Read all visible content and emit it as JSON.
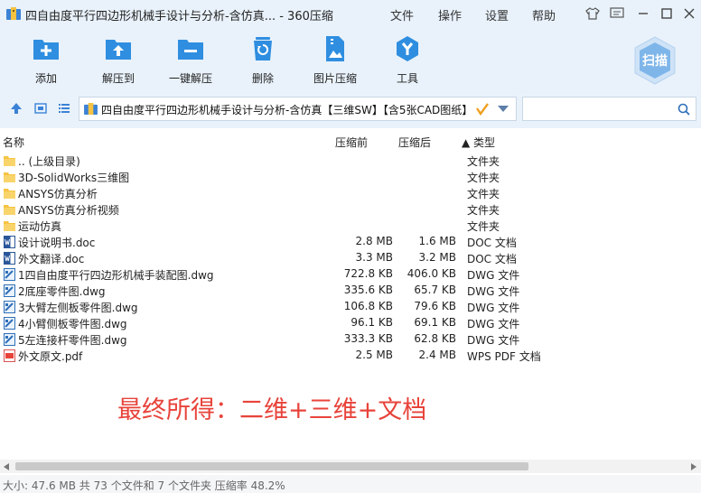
{
  "window": {
    "title": "四自由度平行四边形机械手设计与分析-含仿真... - 360压缩",
    "menus": [
      "文件",
      "操作",
      "设置",
      "帮助"
    ]
  },
  "toolbar": {
    "items": [
      {
        "label": "添加",
        "icon": "add-icon",
        "color": "#2f8ee0"
      },
      {
        "label": "解压到",
        "icon": "extract-icon",
        "color": "#2f8ee0"
      },
      {
        "label": "一键解压",
        "icon": "one-click-extract-icon",
        "color": "#2f8ee0"
      },
      {
        "label": "删除",
        "icon": "trash-icon",
        "color": "#2f8ee0"
      },
      {
        "label": "图片压缩",
        "icon": "image-compress-icon",
        "color": "#2f8ee0"
      },
      {
        "label": "工具",
        "icon": "tools-icon",
        "color": "#2f8ee0"
      }
    ],
    "scan_label": "扫描"
  },
  "address": {
    "path": "四自由度平行四边形机械手设计与分析-含仿真【三维SW】【含5张CAD图纸】",
    "search_placeholder": ""
  },
  "columns": {
    "name": "名称",
    "size": "压缩前",
    "csize": "压缩后",
    "type": "▲ 类型"
  },
  "files": [
    {
      "name": ".. (上级目录)",
      "size": "",
      "csize": "",
      "type": "文件夹",
      "kind": "folder"
    },
    {
      "name": "3D-SolidWorks三维图",
      "size": "",
      "csize": "",
      "type": "文件夹",
      "kind": "folder"
    },
    {
      "name": "ANSYS仿真分析",
      "size": "",
      "csize": "",
      "type": "文件夹",
      "kind": "folder"
    },
    {
      "name": "ANSYS仿真分析视频",
      "size": "",
      "csize": "",
      "type": "文件夹",
      "kind": "folder"
    },
    {
      "name": "运动仿真",
      "size": "",
      "csize": "",
      "type": "文件夹",
      "kind": "folder"
    },
    {
      "name": "设计说明书.doc",
      "size": "2.8 MB",
      "csize": "1.6 MB",
      "type": "DOC 文档",
      "kind": "doc"
    },
    {
      "name": "外文翻译.doc",
      "size": "3.3 MB",
      "csize": "3.2 MB",
      "type": "DOC 文档",
      "kind": "doc"
    },
    {
      "name": "1四自由度平行四边形机械手装配图.dwg",
      "size": "722.8 KB",
      "csize": "406.0 KB",
      "type": "DWG 文件",
      "kind": "dwg"
    },
    {
      "name": "2底座零件图.dwg",
      "size": "335.6 KB",
      "csize": "65.7 KB",
      "type": "DWG 文件",
      "kind": "dwg"
    },
    {
      "name": "3大臂左侧板零件图.dwg",
      "size": "106.8 KB",
      "csize": "79.6 KB",
      "type": "DWG 文件",
      "kind": "dwg"
    },
    {
      "name": "4小臂侧板零件图.dwg",
      "size": "96.1 KB",
      "csize": "69.1 KB",
      "type": "DWG 文件",
      "kind": "dwg"
    },
    {
      "name": "5左连接杆零件图.dwg",
      "size": "333.3 KB",
      "csize": "62.8 KB",
      "type": "DWG 文件",
      "kind": "dwg"
    },
    {
      "name": "外文原文.pdf",
      "size": "2.5 MB",
      "csize": "2.4 MB",
      "type": "WPS PDF 文档",
      "kind": "pdf"
    }
  ],
  "overlay_text": "最终所得：二维+三维+文档",
  "status": "大小: 47.6 MB 共 73 个文件和 7 个文件夹 压缩率 48.2%"
}
